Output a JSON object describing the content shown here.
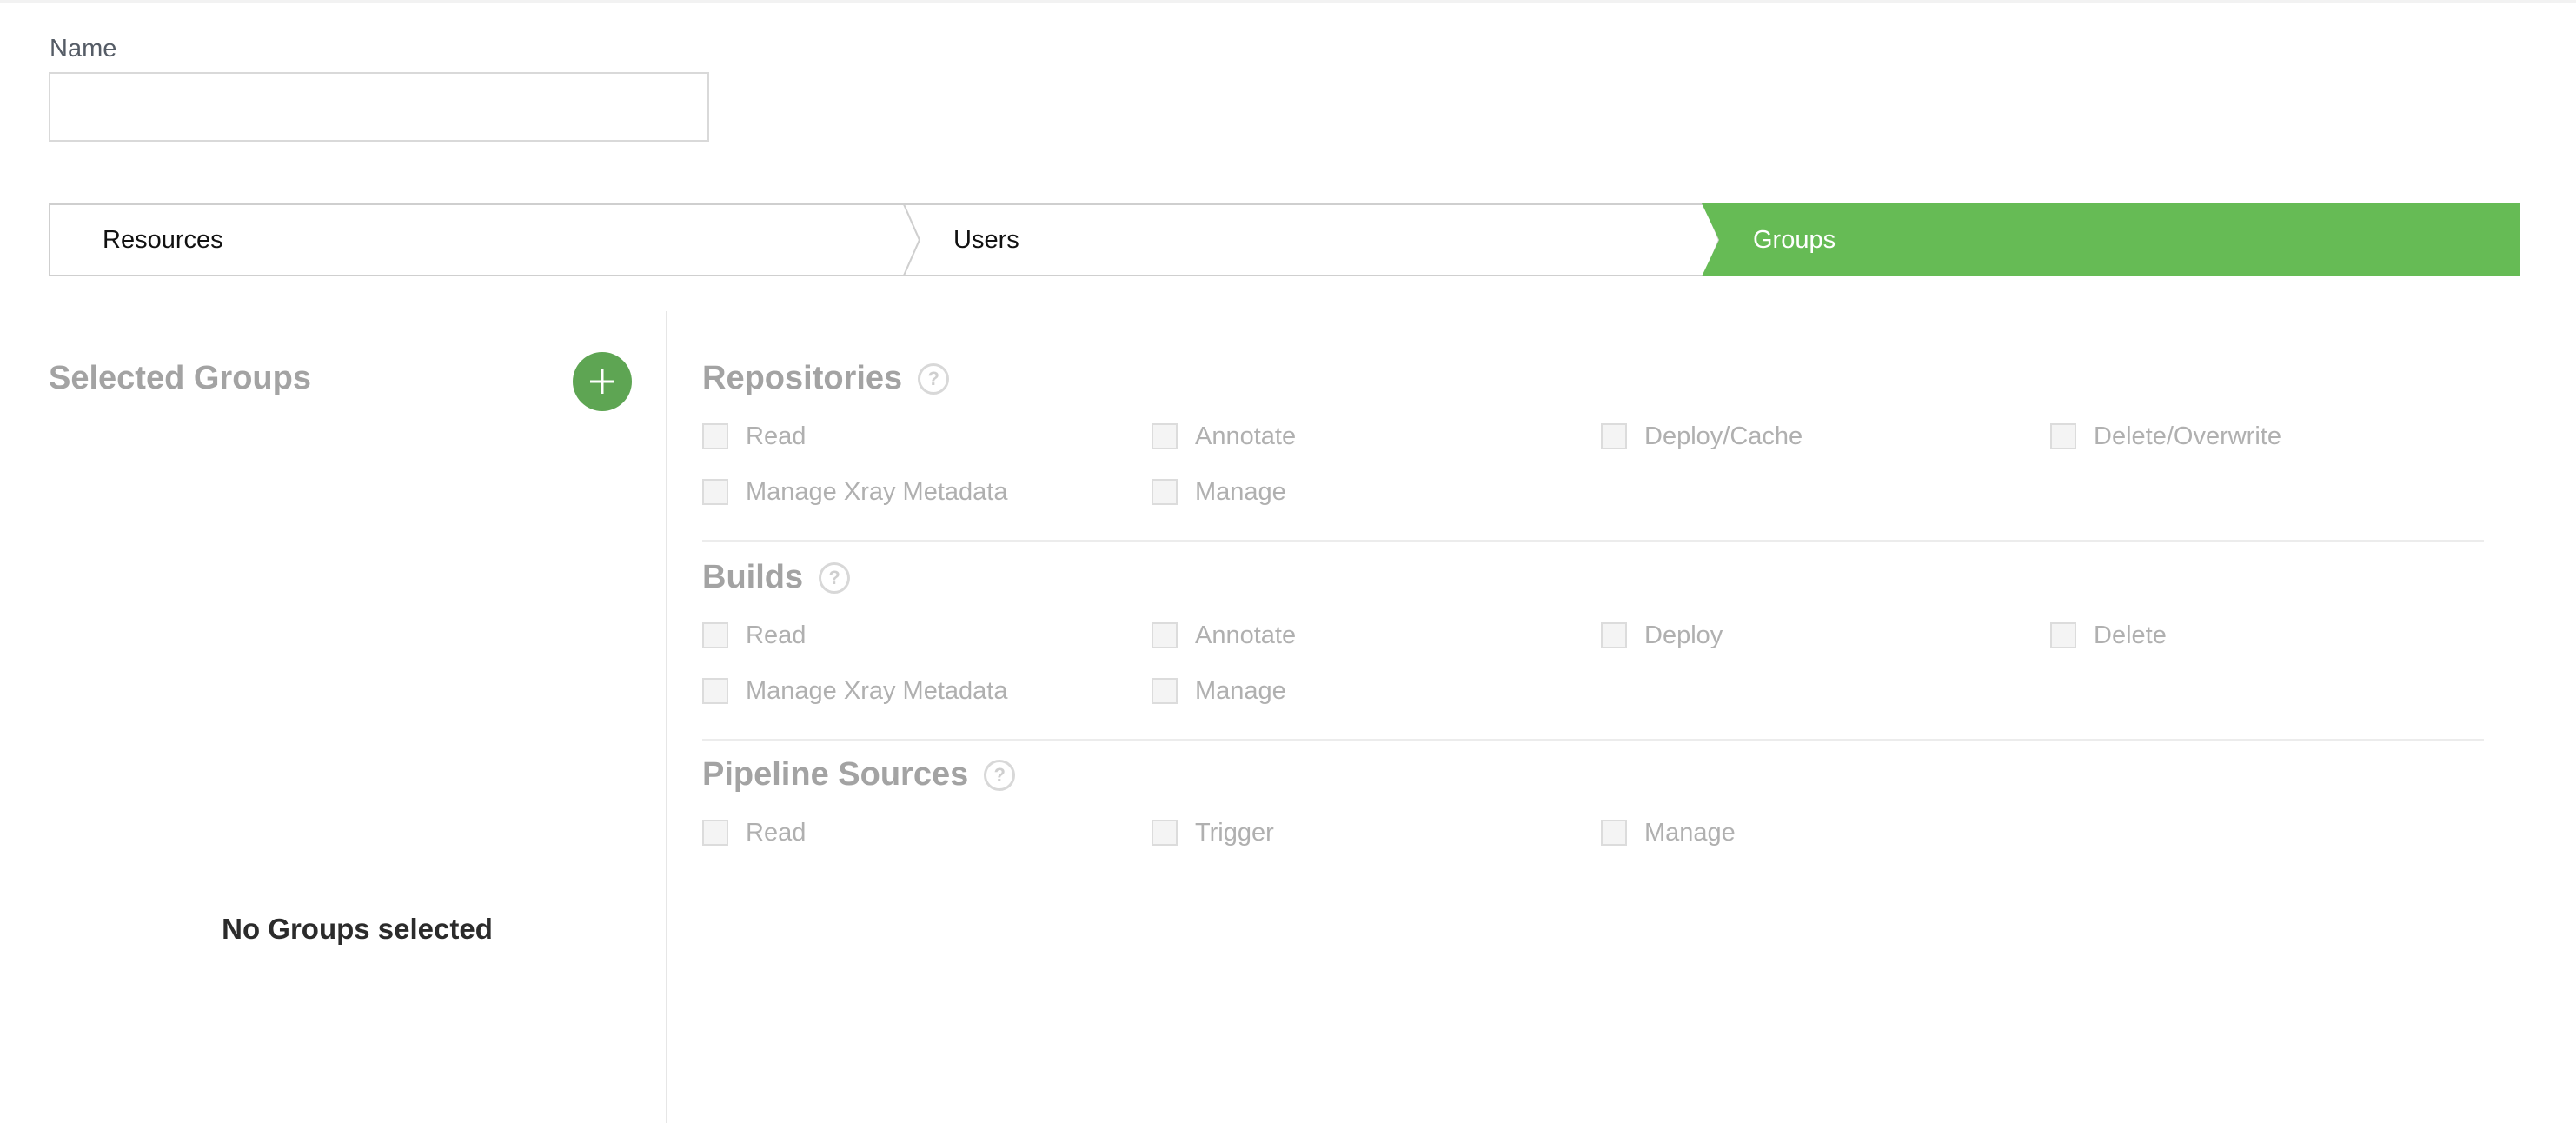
{
  "form": {
    "name_label": "Name",
    "name_value": "",
    "name_placeholder": ""
  },
  "stepper": {
    "tabs": [
      {
        "label": "Resources",
        "active": false
      },
      {
        "label": "Users",
        "active": false
      },
      {
        "label": "Groups",
        "active": true
      }
    ],
    "active_color": "#66bb55"
  },
  "left_panel": {
    "title": "Selected Groups",
    "add_icon": "plus-icon",
    "empty_message": "No Groups selected"
  },
  "permissions": {
    "sections": [
      {
        "title": "Repositories",
        "help_icon": "question-icon",
        "help_glyph": "?",
        "rows": [
          [
            "Read",
            "Annotate",
            "Deploy/Cache",
            "Delete/Overwrite"
          ],
          [
            "Manage Xray Metadata",
            "Manage"
          ]
        ]
      },
      {
        "title": "Builds",
        "help_icon": "question-icon",
        "help_glyph": "?",
        "rows": [
          [
            "Read",
            "Annotate",
            "Deploy",
            "Delete"
          ],
          [
            "Manage Xray Metadata",
            "Manage"
          ]
        ]
      },
      {
        "title": "Pipeline Sources",
        "help_icon": "question-icon",
        "help_glyph": "?",
        "rows": [
          [
            "Read",
            "Trigger",
            "Manage"
          ]
        ]
      }
    ]
  }
}
